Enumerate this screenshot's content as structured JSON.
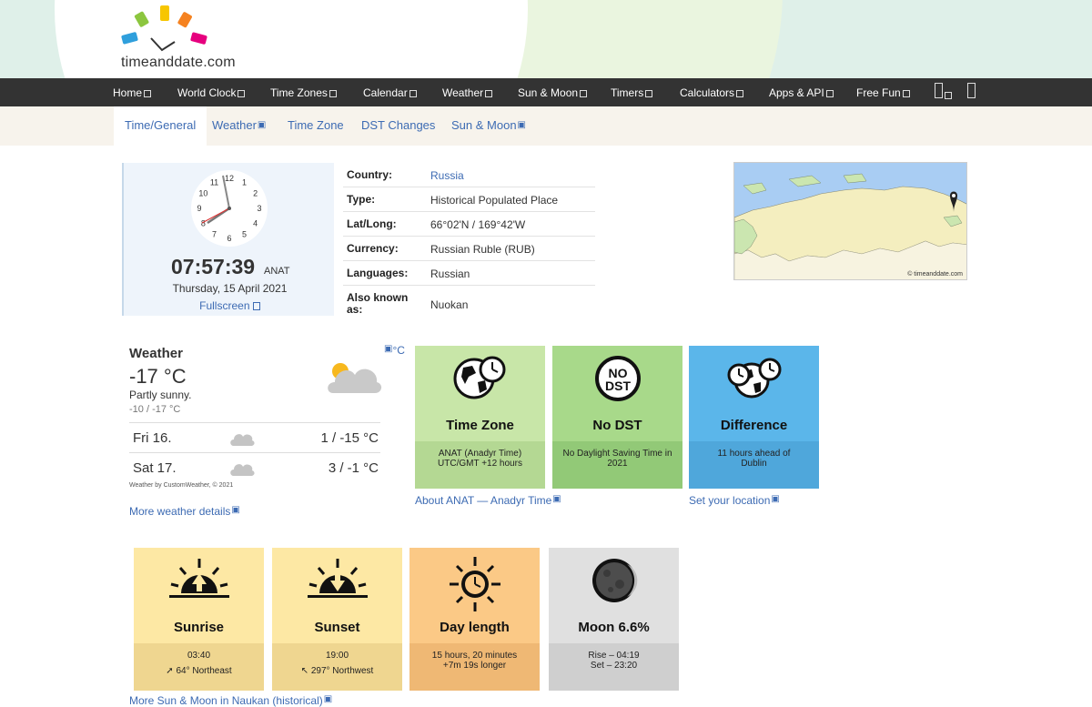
{
  "header": {
    "logo_text": "timeanddate.com"
  },
  "nav": {
    "items": [
      "Home",
      "World Clock",
      "Time Zones",
      "Calendar",
      "Weather",
      "Sun & Moon",
      "Timers",
      "Calculators",
      "Apps & API",
      "Free Fun"
    ]
  },
  "subnav": {
    "items": [
      "Time/General",
      "Weather",
      "Time Zone",
      "DST Changes",
      "Sun & Moon"
    ]
  },
  "clock": {
    "time": "07:57:39",
    "tz": "ANAT",
    "date": "Thursday, 15 April 2021",
    "fullscreen": "Fullscreen",
    "numbers": [
      "12",
      "1",
      "2",
      "3",
      "4",
      "5",
      "6",
      "7",
      "8",
      "9",
      "10",
      "11"
    ]
  },
  "info": {
    "country_label": "Country:",
    "country": "Russia",
    "type_label": "Type:",
    "type": "Historical Populated Place",
    "latlong_label": "Lat/Long:",
    "latlong": "66°02'N / 169°42'W",
    "currency_label": "Currency:",
    "currency": "Russian Ruble (RUB)",
    "languages_label": "Languages:",
    "languages": "Russian",
    "aka_label": "Also known as:",
    "aka": "Nuokan"
  },
  "map": {
    "copyright": "© timeanddate.com"
  },
  "weather": {
    "title": "Weather",
    "unit_toggle": "°C",
    "temp": "-17 °C",
    "desc": "Partly sunny.",
    "range": "-10 / -17 °C",
    "forecast": [
      {
        "day": "Fri 16.",
        "temp": "1 / -15 °C"
      },
      {
        "day": "Sat 17.",
        "temp": "3 / -1 °C"
      }
    ],
    "credit": "Weather by CustomWeather, © 2021",
    "more": "More weather details"
  },
  "tiles": {
    "timezone": {
      "title": "Time Zone",
      "line1": "ANAT (Anadyr Time)",
      "line2": "UTC/GMT +12 hours"
    },
    "nodst": {
      "title": "No DST",
      "badge_line1": "NO",
      "badge_line2": "DST",
      "line1": "No Daylight Saving Time in",
      "line2": "2021"
    },
    "difference": {
      "title": "Difference",
      "line1": "11 hours ahead of",
      "line2": "Dublin"
    },
    "about_link": "About ANAT — Anadyr Time",
    "location_link": "Set your location",
    "sunrise": {
      "title": "Sunrise",
      "line1": "03:40",
      "line2": "64° Northeast"
    },
    "sunset": {
      "title": "Sunset",
      "line1": "19:00",
      "line2": "297° Northwest"
    },
    "daylength": {
      "title": "Day length",
      "line1": "15 hours, 20 minutes",
      "line2": "+7m 19s longer"
    },
    "moon": {
      "title": "Moon 6.6%",
      "line1": "Rise – 04:19",
      "line2": "Set – 23:20"
    }
  },
  "more_sun": "More Sun & Moon in Naukan (historical)",
  "colors": {
    "nav_bg": "#333333",
    "link": "#3d6bb3",
    "tile_green_light": "#c8e6a8",
    "tile_green": "#a8d98a",
    "tile_blue": "#5bb6ea",
    "tile_yellow": "#fde8a4",
    "tile_orange": "#fbc986",
    "tile_gray": "#e0e0e0"
  }
}
